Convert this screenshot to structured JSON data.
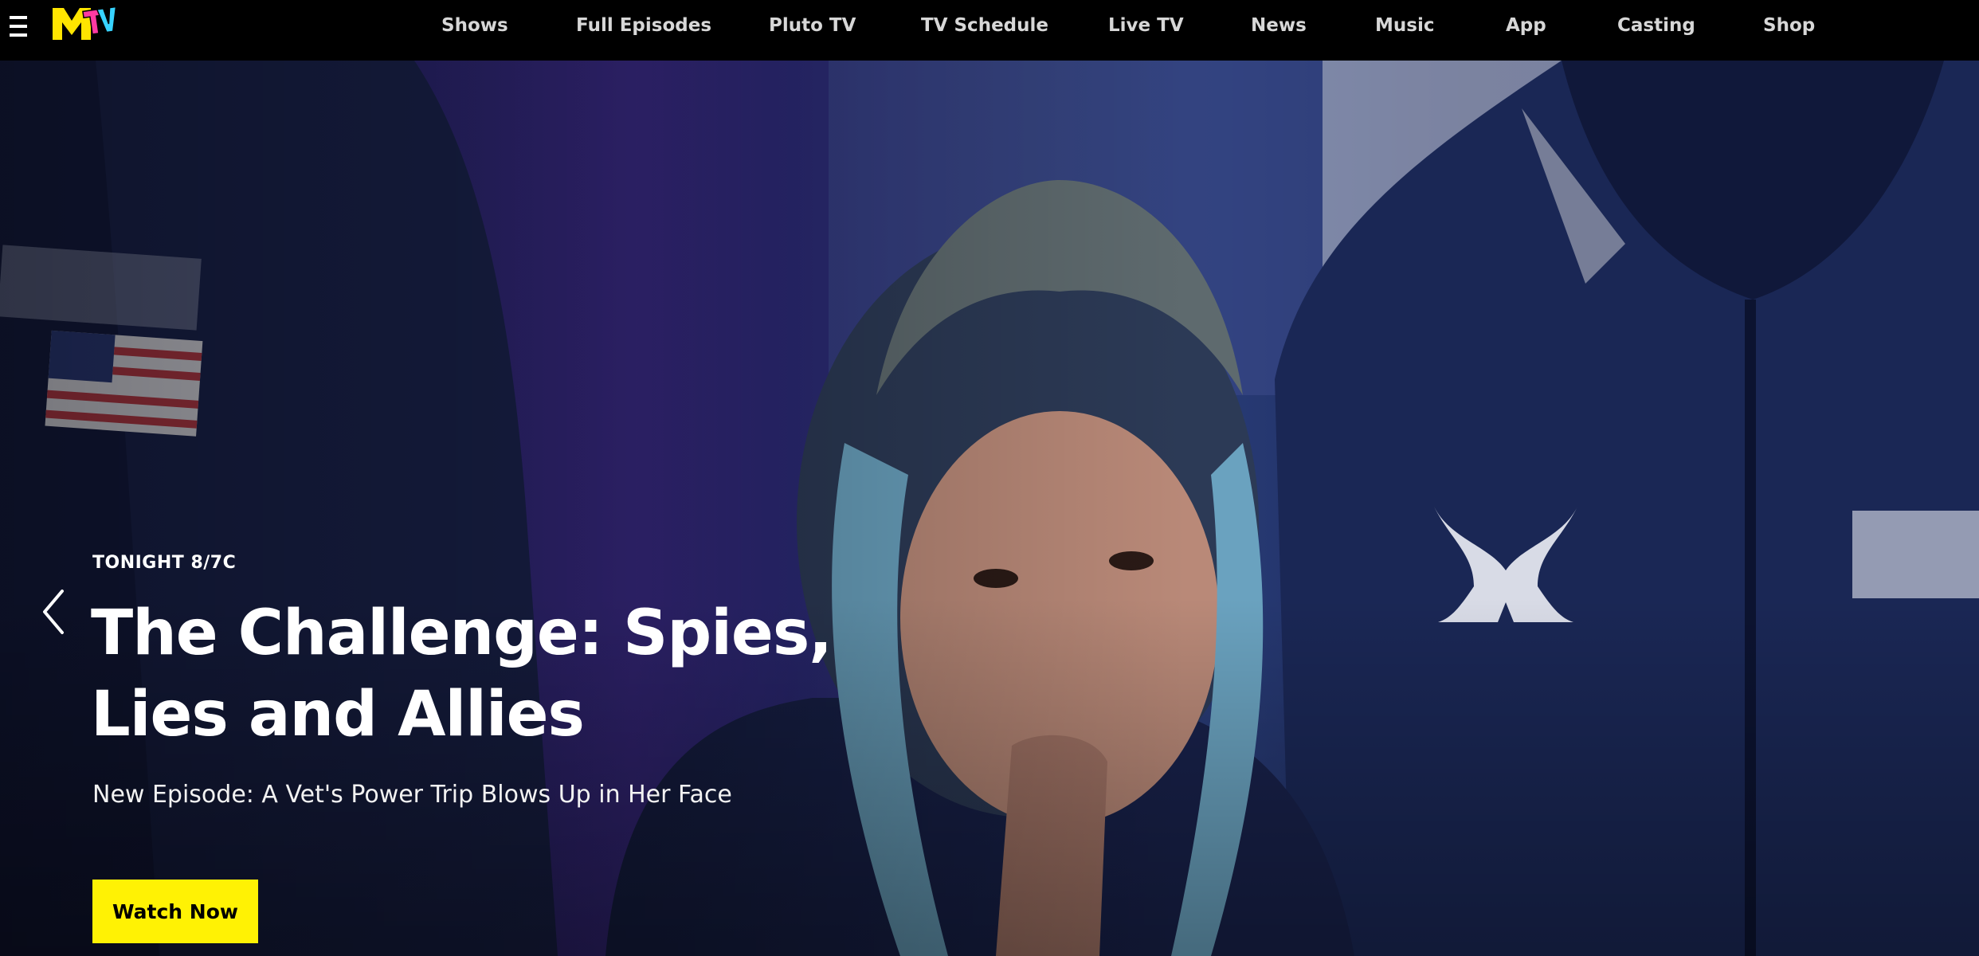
{
  "nav": {
    "menu_icon": "hamburger-icon",
    "logo": "MTV",
    "items": [
      "Shows",
      "Full Episodes",
      "Pluto TV",
      "TV Schedule",
      "Live TV",
      "News",
      "Music",
      "App",
      "Casting",
      "Shop"
    ]
  },
  "hero": {
    "kicker": "TONIGHT 8/7C",
    "title": "The Challenge: Spies, Lies and Allies",
    "subtitle": "New Episode: A Vet's Power Trip Blows Up in Her Face",
    "cta": "Watch Now",
    "prev_icon": "chevron-left-icon"
  },
  "colors": {
    "nav_bg": "#000000",
    "cta_bg": "#fff204",
    "logo_yellow": "#ffe500"
  }
}
